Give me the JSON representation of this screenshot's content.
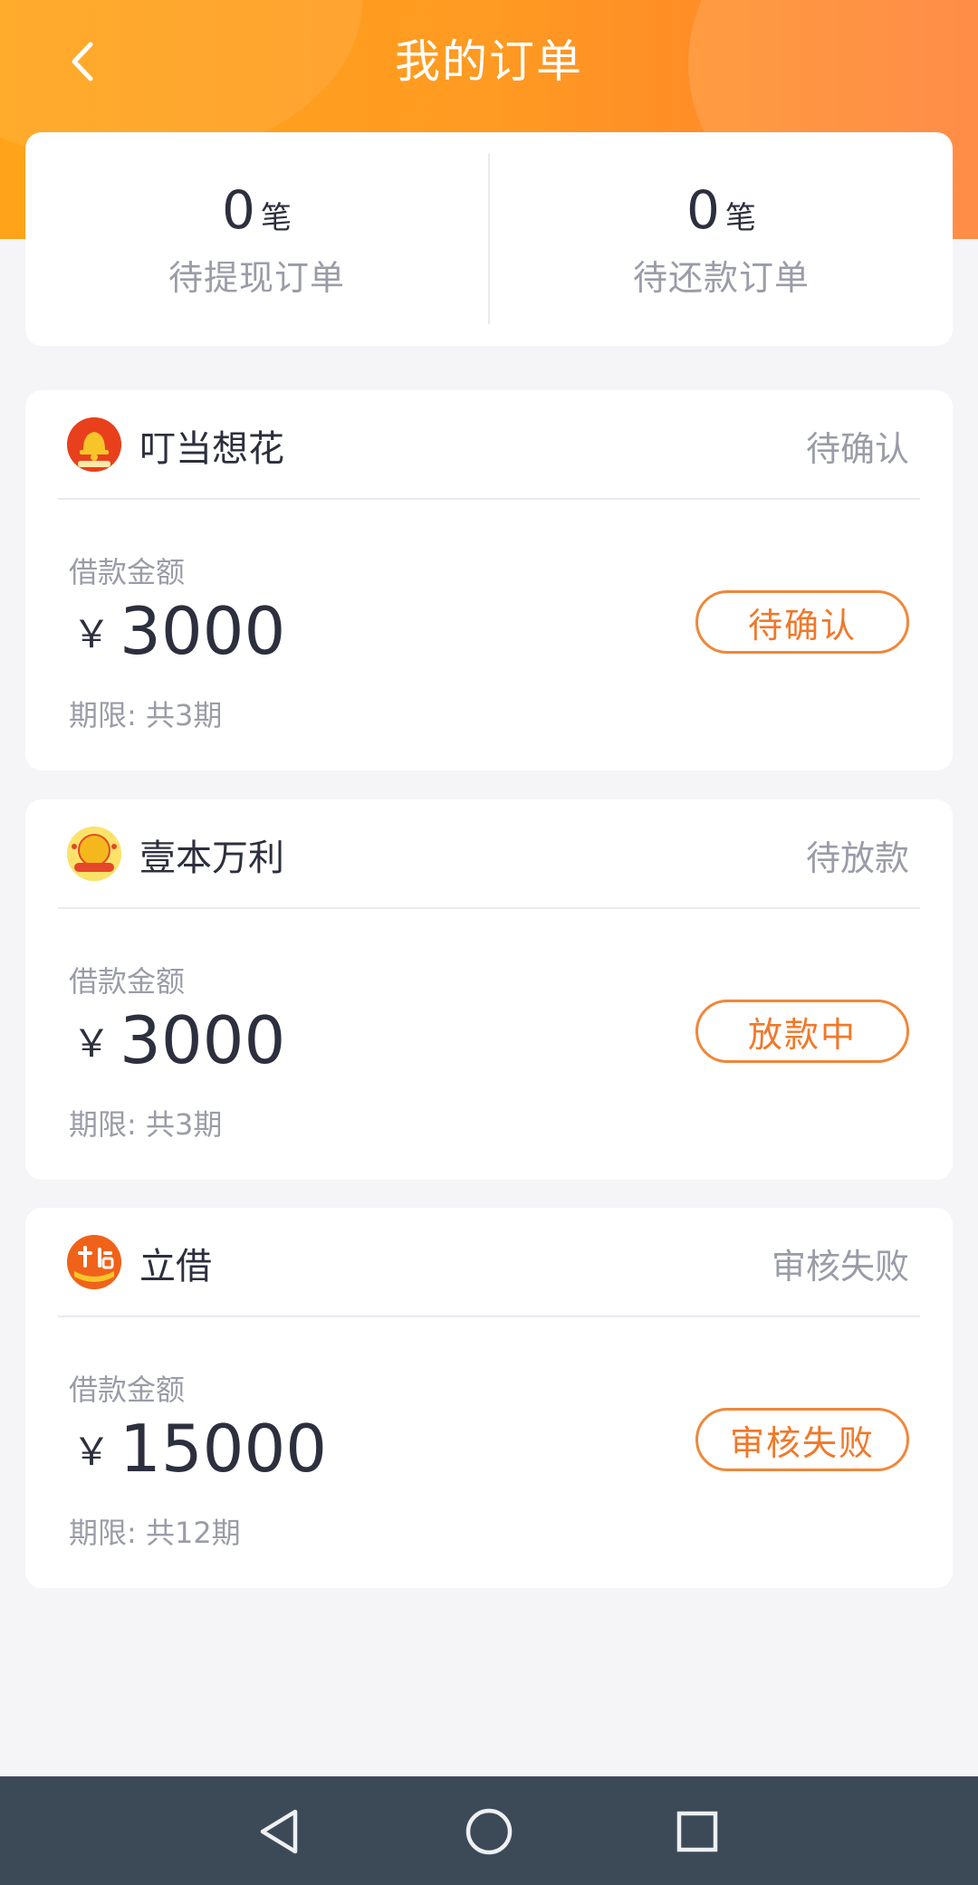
{
  "header": {
    "title": "我的订单",
    "back_icon": "chevron-left-icon"
  },
  "summary": {
    "items": [
      {
        "count": "0",
        "unit": "笔",
        "label": "待提现订单"
      },
      {
        "count": "0",
        "unit": "笔",
        "label": "待还款订单"
      }
    ]
  },
  "orders": [
    {
      "app_name": "叮当想花",
      "head_status": "待确认",
      "amount_label": "借款金额",
      "currency": "￥",
      "amount": "3000",
      "term": "期限: 共3期",
      "button": "待确认",
      "logo_icon": "bell-logo-icon",
      "logo_text": "叮当想花"
    },
    {
      "app_name": "壹本万利",
      "head_status": "待放款",
      "amount_label": "借款金额",
      "currency": "￥",
      "amount": "3000",
      "term": "期限: 共3期",
      "button": "放款中",
      "logo_icon": "coin-logo-icon",
      "logo_text": "壹本万利"
    },
    {
      "app_name": "立借",
      "head_status": "审核失败",
      "amount_label": "借款金额",
      "currency": "￥",
      "amount": "15000",
      "term": "期限: 共12期",
      "button": "审核失败",
      "logo_icon": "lijie-logo-icon",
      "logo_text": "立借"
    }
  ],
  "navbar": {
    "back_icon": "triangle-back-icon",
    "home_icon": "circle-home-icon",
    "recents_icon": "square-recents-icon"
  },
  "colors": {
    "accent": "#ff9a22",
    "button_border": "#f0873a",
    "button_text": "#f0782a",
    "navbar": "#3c4a58"
  }
}
